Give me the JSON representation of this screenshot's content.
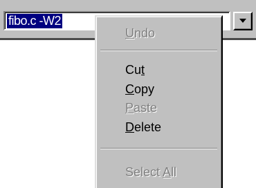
{
  "combo": {
    "value": "fibo.c -W2",
    "dropdown_icon": "down-arrow-icon"
  },
  "menu": {
    "items": [
      {
        "before": "",
        "accel": "U",
        "after": "ndo",
        "enabled": false
      },
      {
        "before": "Cu",
        "accel": "t",
        "after": "",
        "enabled": true
      },
      {
        "before": "",
        "accel": "C",
        "after": "opy",
        "enabled": true
      },
      {
        "before": "",
        "accel": "P",
        "after": "aste",
        "enabled": false
      },
      {
        "before": "",
        "accel": "D",
        "after": "elete",
        "enabled": true
      },
      {
        "before": "Select ",
        "accel": "A",
        "after": "ll",
        "enabled": false
      }
    ]
  },
  "colors": {
    "face": "#c0c0c0",
    "selection": "#000080",
    "disabled_text": "#808080"
  }
}
